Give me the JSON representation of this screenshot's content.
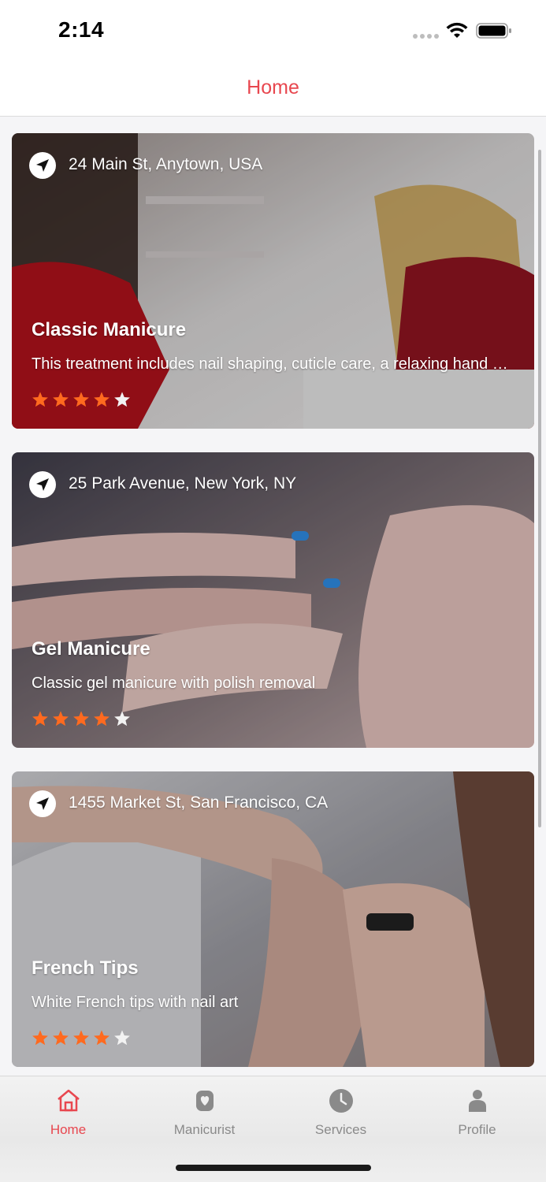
{
  "status_bar": {
    "time": "2:14"
  },
  "nav": {
    "title": "Home"
  },
  "colors": {
    "accent": "#e8474f",
    "star_filled": "#ff6a1f",
    "star_empty": "#f2f2f2"
  },
  "services": [
    {
      "location": "24 Main St, Anytown, USA",
      "title": "Classic Manicure",
      "description": "This treatment includes nail shaping, cuticle care, a relaxing hand massage, and polish application.",
      "rating": 4,
      "rating_max": 5
    },
    {
      "location": "25 Park Avenue, New York, NY",
      "title": "Gel Manicure",
      "description": "Classic gel manicure with polish removal",
      "rating": 4,
      "rating_max": 5
    },
    {
      "location": "1455 Market St, San Francisco, CA",
      "title": "French Tips",
      "description": "White French tips with nail art",
      "rating": 4,
      "rating_max": 5
    }
  ],
  "tabs": [
    {
      "label": "Home",
      "icon": "home-icon",
      "active": true
    },
    {
      "label": "Manicurist",
      "icon": "manicurist-icon",
      "active": false
    },
    {
      "label": "Services",
      "icon": "clock-icon",
      "active": false
    },
    {
      "label": "Profile",
      "icon": "person-icon",
      "active": false
    }
  ]
}
